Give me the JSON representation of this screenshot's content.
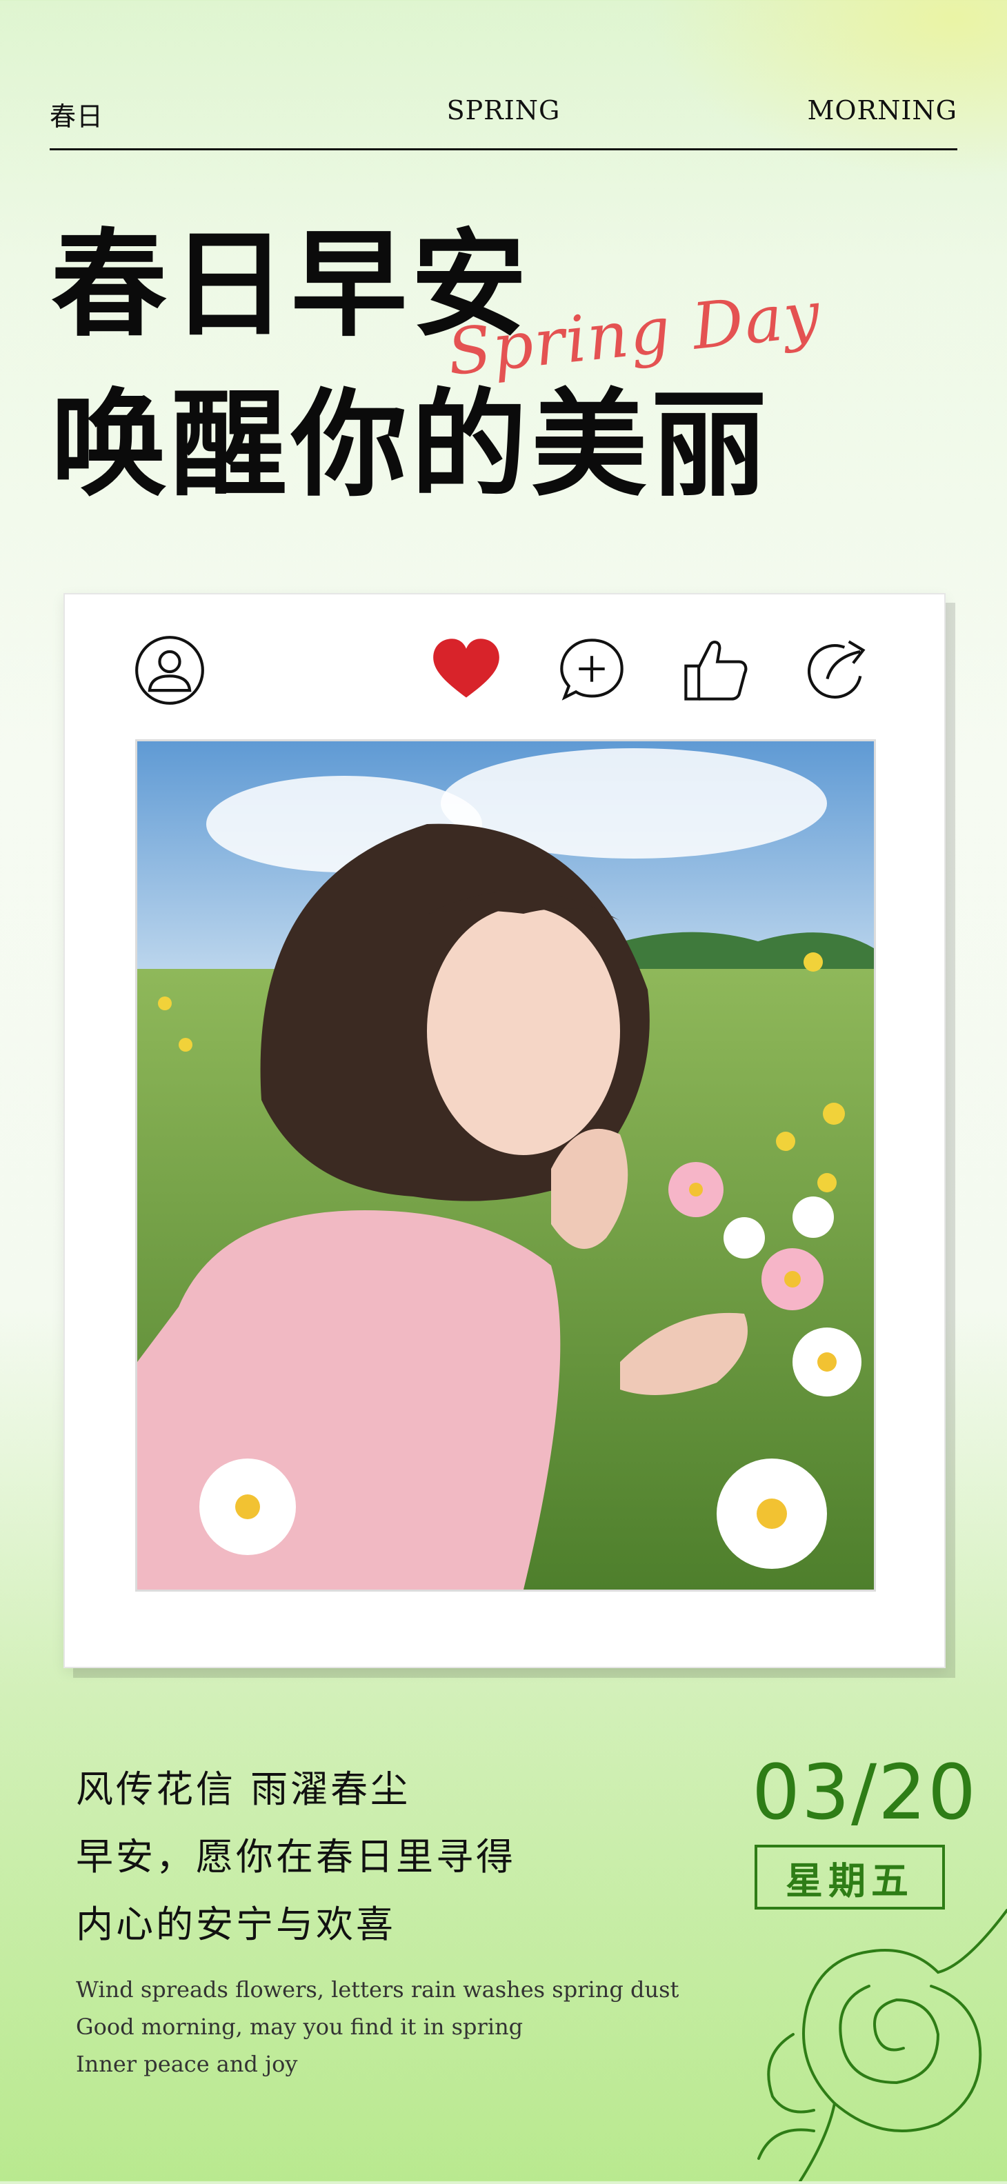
{
  "header": {
    "left": "春日",
    "center": "SPRING",
    "right": "MORNING"
  },
  "headline": {
    "line1": "春日早安",
    "line2": "唤醒你的美丽",
    "script": "Spring Day"
  },
  "card": {
    "icons": [
      "user-icon",
      "heart-icon",
      "add-icon",
      "thumbs-up-icon",
      "share-icon"
    ],
    "accent": "#d8232a"
  },
  "poem": {
    "lines": [
      "风传花信  雨濯春尘",
      "早安，愿你在春日里寻得",
      "内心的安宁与欢喜"
    ],
    "english": [
      "Wind spreads flowers, letters rain washes spring dust",
      "Good morning, may you find it in spring",
      "Inner peace and joy"
    ]
  },
  "date": {
    "value": "03/20",
    "weekday": "星期五",
    "color": "#2e7d16"
  }
}
